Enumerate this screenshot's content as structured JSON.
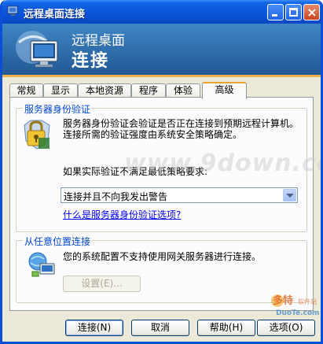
{
  "window": {
    "title": "远程桌面连接"
  },
  "banner": {
    "line1": "远程桌面",
    "line2": "连接"
  },
  "tabs": [
    {
      "label": "常规",
      "active": false
    },
    {
      "label": "显示",
      "active": false
    },
    {
      "label": "本地资源",
      "active": false
    },
    {
      "label": "程序",
      "active": false
    },
    {
      "label": "体验",
      "active": false
    },
    {
      "label": "高级",
      "active": true
    }
  ],
  "server_auth": {
    "title": "服务器身份验证",
    "description_line1": "服务器身份验证会验证是否正在连接到预期远程计算机。",
    "description_line2": "连接所需的验证强度由系统安全策略确定。",
    "prompt": "如果实际验证不满足最低策略要求:",
    "selected_option": "连接并且不向我发出警告",
    "link": "什么是服务器身份验证选项?"
  },
  "anywhere": {
    "title": "从任意位置连接",
    "description": "您的系统配置不支持使用网关服务器进行连接。",
    "settings_button": "设置(E)..."
  },
  "buttons": {
    "connect": "连接(N)",
    "cancel": "取消",
    "help": "帮助(H)",
    "options": "选项(O)"
  },
  "watermark": {
    "text": "www.9down.com",
    "logo_text": "多特软件站",
    "logo_sub": "DuoTe.com"
  },
  "colors": {
    "title_bar": "#0a55d8",
    "banner": "#2d6aa8",
    "group_title": "#0046d5",
    "link": "#0000ff",
    "tab_highlight": "#f0a330"
  }
}
